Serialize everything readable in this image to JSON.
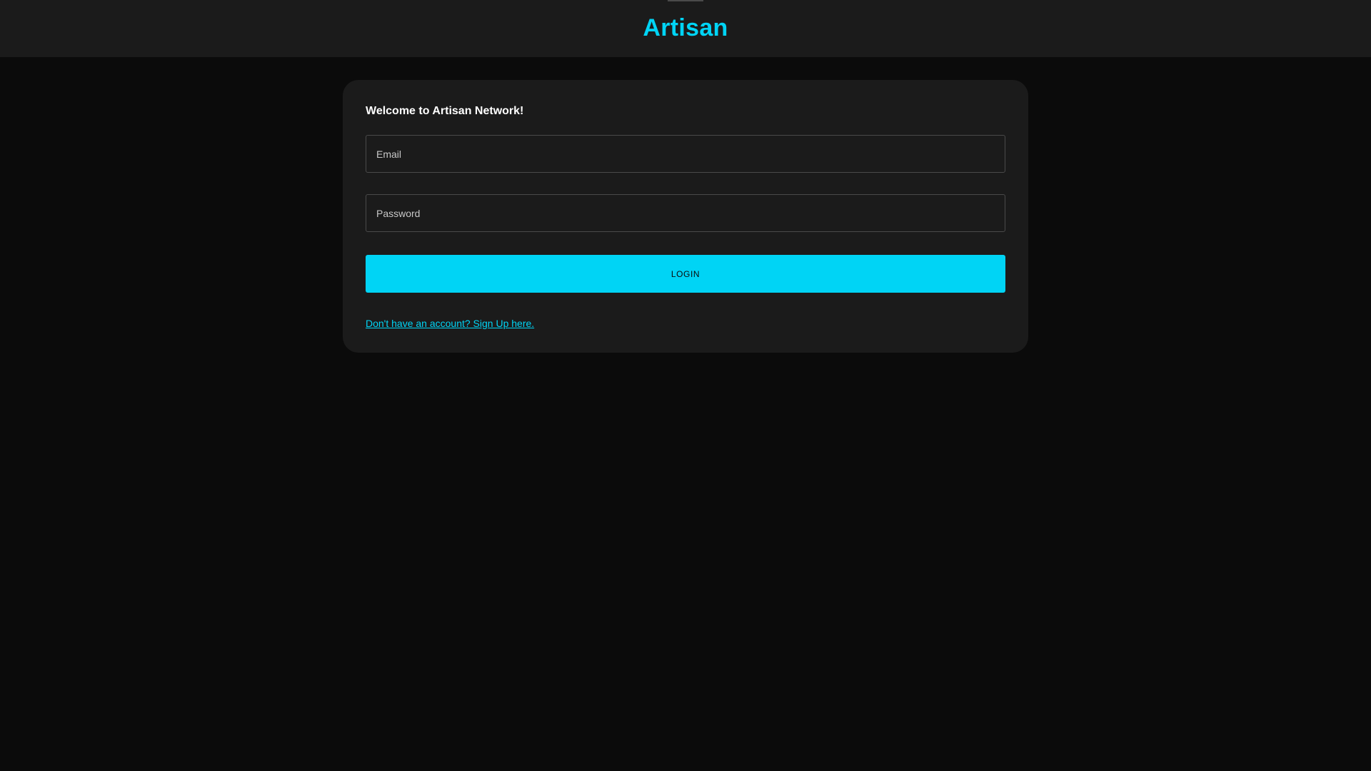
{
  "header": {
    "brand": "Artisan"
  },
  "card": {
    "welcome": "Welcome to Artisan Network!",
    "email_placeholder": "Email",
    "password_placeholder": "Password",
    "login_label": "LOGIN",
    "signup_link": "Don't have an account? Sign Up here."
  },
  "colors": {
    "accent": "#00d4f5",
    "background": "#0b0b0b",
    "surface": "#1b1b1b"
  }
}
